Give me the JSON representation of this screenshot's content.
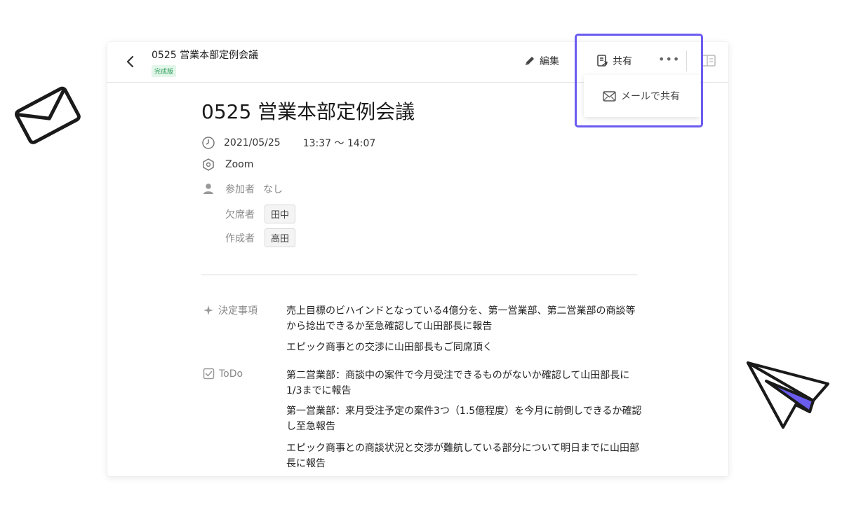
{
  "header": {
    "doc_title": "0525 営業本部定例会議",
    "status_badge": "完成版",
    "edit_label": "編集",
    "share_label": "共有",
    "more_label": "•••"
  },
  "share_menu": {
    "email_share_label": "メールで共有"
  },
  "meeting": {
    "title": "0525 営業本部定例会議",
    "date": "2021/05/25",
    "time": "13:37 〜 14:07",
    "location": "Zoom",
    "participants_label": "参加者",
    "participants_value": "なし",
    "absent_label": "欠席者",
    "absent_value": "田中",
    "author_label": "作成者",
    "author_value": "高田"
  },
  "decisions": {
    "label": "決定事項",
    "items": [
      "売上目標のビハインドとなっている4億分を、第一営業部、第二営業部の商談等から捻出できるか至急確認して山田部長に報告",
      "エピック商事との交渉に山田部長もご同席頂く"
    ]
  },
  "todo": {
    "label": "ToDo",
    "items": [
      "第二営業部：商談中の案件で今月受注できるものがないか確認して山田部長に1/3までに報告",
      "第一営業部：来月受注予定の案件3つ（1.5億程度）を今月に前倒しできるか確認し至急報告",
      "エピック商事との商談状況と交渉が難航している部分について明日までに山田部長に報告"
    ]
  },
  "colors": {
    "accent": "#6b5cf0",
    "badge_text": "#2b9c57",
    "badge_bg": "#e3f6ea"
  }
}
